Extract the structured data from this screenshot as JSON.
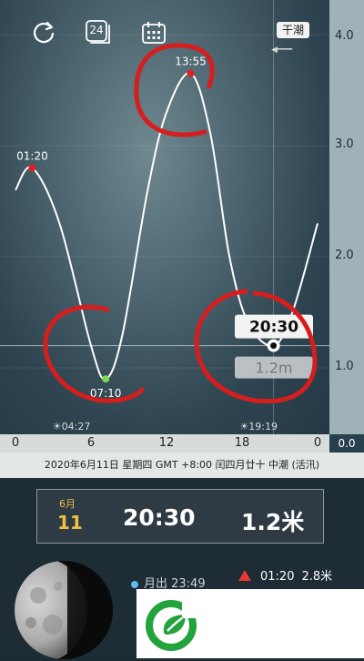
{
  "toolbar": {
    "refresh_icon": "refresh-icon",
    "day24_label": "24",
    "calendar_icon": "calendar-icon",
    "tide_badge": "干潮"
  },
  "chart_data": {
    "type": "line",
    "x_unit": "hour",
    "xlim": [
      0,
      24
    ],
    "ylim": [
      0.0,
      4.0
    ],
    "y_ticks": [
      "4.0",
      "3.0",
      "2.0",
      "1.0",
      "0.0"
    ],
    "x_ticks": [
      "0",
      "6",
      "12",
      "18",
      "0"
    ],
    "series": [
      {
        "values_x": [
          0,
          1.33,
          3.5,
          6,
          7.17,
          8.5,
          10.5,
          12,
          13.92,
          15.5,
          17,
          18.5,
          20.5,
          22,
          24
        ],
        "values_y": [
          2.6,
          2.8,
          2.3,
          1.2,
          0.9,
          1.3,
          2.6,
          3.3,
          3.65,
          3.1,
          2.0,
          1.4,
          1.2,
          1.5,
          2.3
        ]
      }
    ],
    "extremes": [
      {
        "time": "01:20",
        "height": 2.8,
        "kind": "high"
      },
      {
        "time": "07:10",
        "height": 0.9,
        "kind": "low"
      },
      {
        "time": "13:55",
        "height": 3.65,
        "kind": "high"
      }
    ],
    "sunrise": "04:27",
    "sunset": "19:19",
    "cursor": {
      "time": "20:30",
      "height": "1.2m"
    },
    "colors": {
      "line": "#ffffff",
      "high_marker": "#e02020",
      "low_marker": "#7ed957",
      "annotation": "#d61e1e"
    }
  },
  "datebar": {
    "text": "2020年6月11日  星期四  GMT +8:00  闰四月廿十  中潮 (活汛)"
  },
  "info": {
    "month": "6月",
    "day": "11",
    "time": "20:30",
    "height": "1.2米"
  },
  "moon": {
    "rise_label": "月出 23:49"
  },
  "tides": {
    "high1": {
      "time": "01:20",
      "height": "2.8米"
    }
  },
  "logo": {
    "icon": "green-leaf-logo-icon"
  }
}
